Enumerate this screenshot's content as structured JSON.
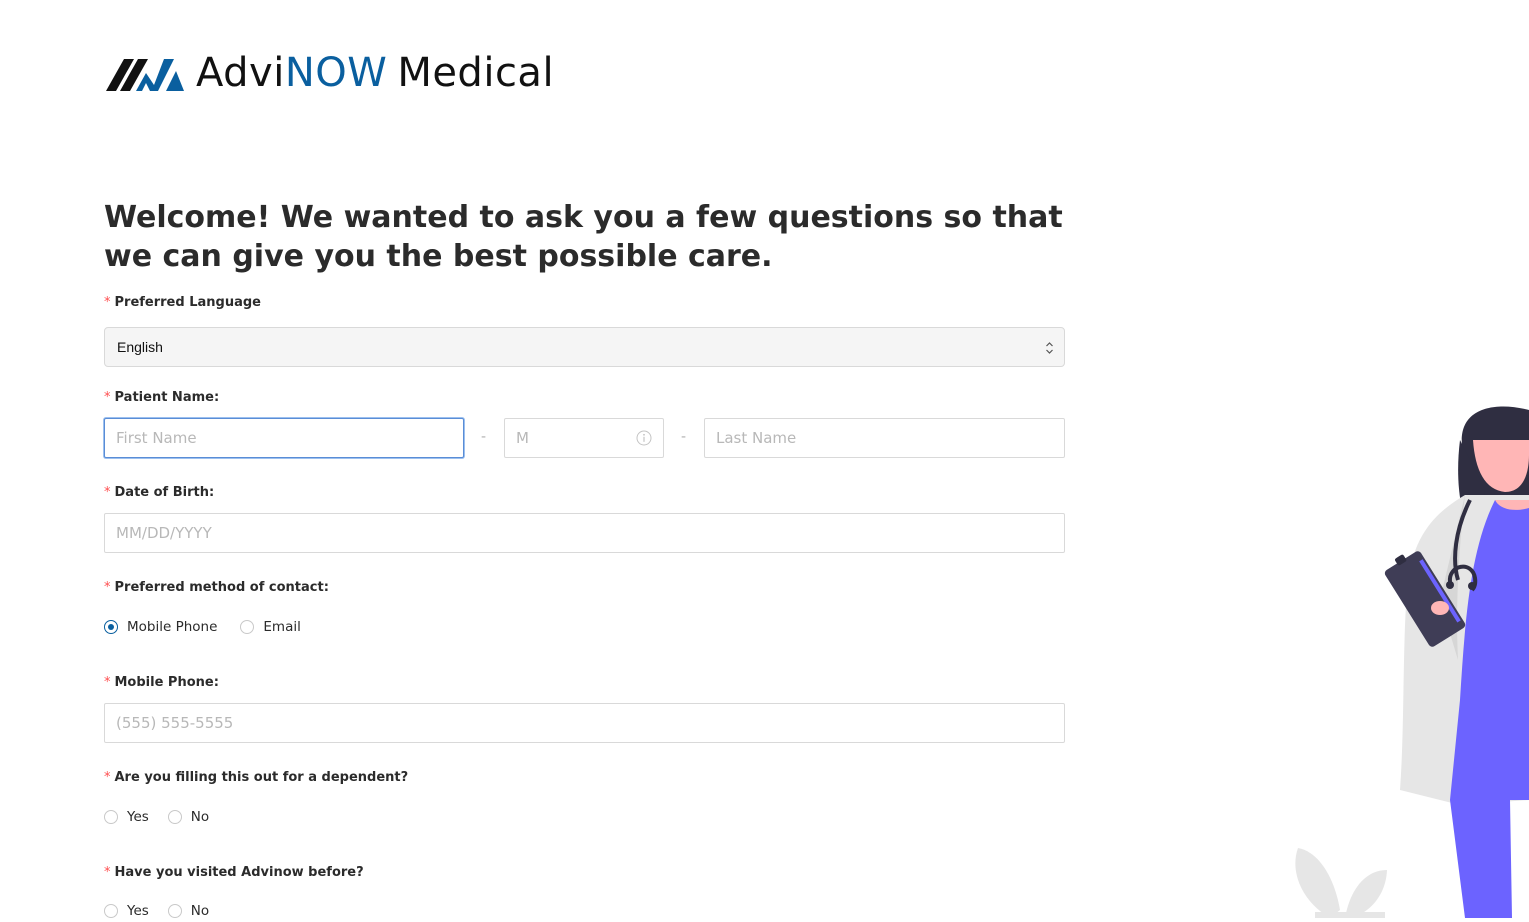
{
  "brand": {
    "name_part1": "Advi",
    "name_part2": "NOW",
    "name_part3": "Medical",
    "color_dark": "#111111",
    "color_blue": "#0a5f9f"
  },
  "heading": "Welcome! We wanted to ask you a few questions so that we can give you the best possible care.",
  "required_marker": "*",
  "fields": {
    "language": {
      "label": "Preferred Language",
      "value": "English"
    },
    "patient_name": {
      "label": "Patient Name:",
      "first_placeholder": "First Name",
      "middle_placeholder": "M",
      "last_placeholder": "Last Name",
      "separator": "-"
    },
    "dob": {
      "label": "Date of Birth:",
      "placeholder": "MM/DD/YYYY"
    },
    "contact_method": {
      "label": "Preferred method of contact:",
      "options": [
        "Mobile Phone",
        "Email"
      ],
      "selected": "Mobile Phone"
    },
    "mobile_phone": {
      "label": "Mobile Phone:",
      "placeholder": "(555) 555-5555"
    },
    "dependent": {
      "label": "Are you filling this out for a dependent?",
      "options": [
        "Yes",
        "No"
      ]
    },
    "visited_before": {
      "label": "Have you visited Advinow before?",
      "options": [
        "Yes",
        "No"
      ]
    }
  },
  "icons": {
    "select_arrows": "chevron-updown-icon",
    "middle_info": "info-icon",
    "illustration": "doctor-illustration"
  },
  "colors": {
    "required": "#ff4d4f",
    "accent": "#0a5f9f",
    "illustration_purple": "#6c63ff"
  }
}
